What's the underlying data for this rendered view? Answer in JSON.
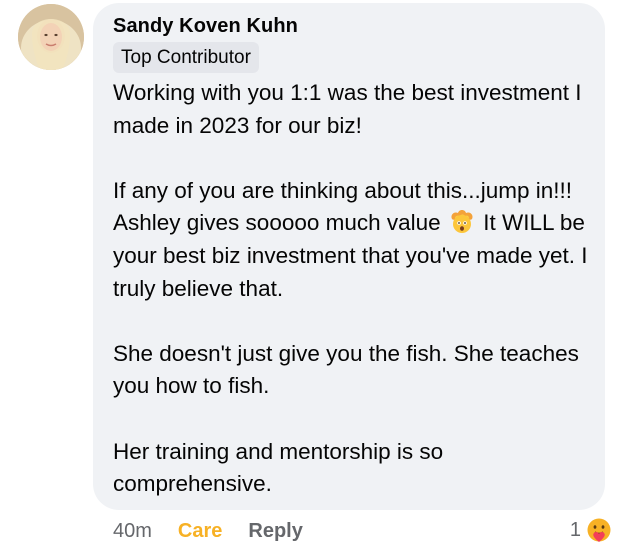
{
  "comment": {
    "author": "Sandy Koven Kuhn",
    "badge": "Top Contributor",
    "paragraphs": {
      "p1": "Working with you 1:1 was the best investment I made in 2023 for our biz!",
      "p2_before": "If any of you are thinking about this...jump in!!! Ashley gives sooooo much value",
      "p2_after": "It WILL be your best biz investment that you've made yet. I truly believe that.",
      "p3": "She doesn't just give you the fish. She teaches you how to fish.",
      "p4": "Her training and mentorship is so comprehensive."
    },
    "inline_emoji": "exploding-head-emoji"
  },
  "actions": {
    "time": "40m",
    "care": "Care",
    "reply": "Reply"
  },
  "reactions": {
    "count": "1",
    "icon": "care-reaction-icon"
  },
  "colors": {
    "bubble": "#f0f2f5",
    "badge": "#e4e6eb",
    "care_accent": "#f7b125",
    "muted_text": "#65676b"
  }
}
